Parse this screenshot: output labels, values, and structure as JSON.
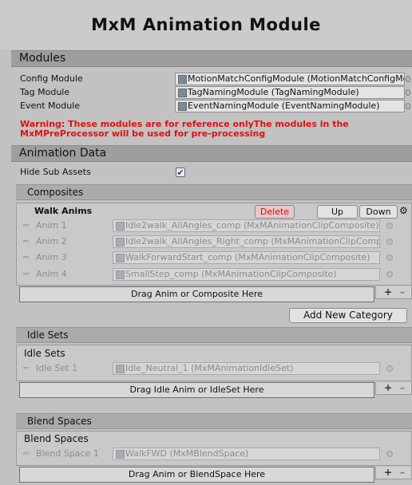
{
  "header": {
    "title": "MxM Animation Module"
  },
  "modules": {
    "heading": "Modules",
    "config_label": "Config Module",
    "config_value": "MotionMatchConfigModule (MotionMatchConfigMod",
    "tag_label": "Tag Module",
    "tag_value": "TagNamingModule (TagNamingModule)",
    "event_label": "Event Module",
    "event_value": "EventNamingModule (EventNamingModule)",
    "warning_line1": "Warning: These modules are for reference onlyThe modules in the",
    "warning_line2": "MxMPreProcessor will be used for pre-processing"
  },
  "animation_data": {
    "heading": "Animation Data",
    "hide_sub_assets_label": "Hide Sub Assets",
    "hide_sub_assets_checked": true
  },
  "composites": {
    "heading": "Composites",
    "category_name": "Walk Anims",
    "delete_label": "Delete",
    "up_label": "Up",
    "down_label": "Down",
    "items": [
      {
        "label": "Anim 1",
        "value": "Idle2walk_AllAngles_comp (MxMAnimationClipComposite)"
      },
      {
        "label": "Anim 2",
        "value": "Idle2walk_AllAngles_Right_comp (MxMAnimationClipCompo"
      },
      {
        "label": "Anim 3",
        "value": "WalkForwardStart_comp (MxMAnimationClipComposite)"
      },
      {
        "label": "Anim 4",
        "value": "SmallStep_comp (MxMAnimationClipComposite)"
      }
    ],
    "drop_label": "Drag Anim or Composite Here",
    "add_category_label": "Add New Category"
  },
  "idle_sets": {
    "heading": "Idle Sets",
    "list_title": "Idle Sets",
    "items": [
      {
        "label": "Idle Set 1",
        "value": "Idle_Neutral_1 (MxMAnimationIdleSet)"
      }
    ],
    "drop_label": "Drag Idle Anim or IdleSet Here"
  },
  "blend_spaces": {
    "heading": "Blend Spaces",
    "list_title": "Blend Spaces",
    "items": [
      {
        "label": "Blend Space 1",
        "value": "WalkFWD (MxMBlendSpace)"
      }
    ],
    "drop_label": "Drag Anim or BlendSpace Here"
  },
  "controls": {
    "plus": "+",
    "minus": "–",
    "handle": "═",
    "gear": "⚙"
  },
  "colors": {
    "warning": "#e01010",
    "delete_text": "#d01010",
    "checkmark": "#1a3c8a"
  },
  "icons": [
    "object-field-icon",
    "object-picker-icon",
    "gear-icon",
    "drag-handle-icon",
    "checkmark-icon"
  ]
}
